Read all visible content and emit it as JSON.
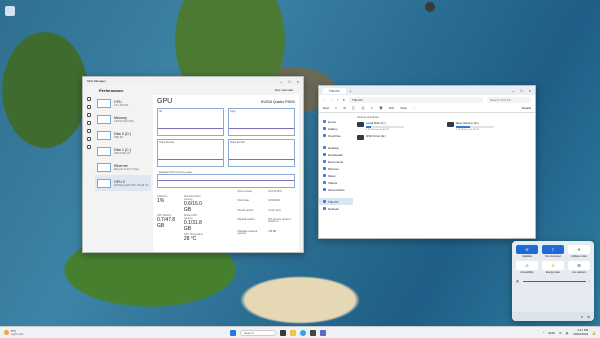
{
  "desktop": {
    "icons": [
      {
        "name": "recycle-bin-icon",
        "label": "Recycle Bin"
      },
      {
        "name": "camera-app-icon",
        "label": "Camera"
      }
    ]
  },
  "task_manager": {
    "window_title": "Task Manager",
    "section": "Performance",
    "run_task": "Run new task",
    "processes": [
      {
        "label": "CPU",
        "sub": "1% 1.59 GHz"
      },
      {
        "label": "Memory",
        "sub": "4.6/31.8 GB (14%)"
      },
      {
        "label": "Disk 0 (D:)",
        "sub": "HDD 0%"
      },
      {
        "label": "Disk 1 (C:)",
        "sub": "SSD NVMe 1%"
      },
      {
        "label": "Ethernet",
        "sub": "Ethernet S: 0 R: 0 Kbps"
      },
      {
        "label": "GPU 0",
        "sub": "NVIDIA Quadro RTX 1% (28 °C)"
      }
    ],
    "gpu": {
      "title": "GPU",
      "model": "NVIDIA Quadro P5000",
      "graphs": [
        "3D",
        "Copy",
        "Video Decode",
        "Video Encode"
      ],
      "dedicated_label": "Dedicated GPU memory usage",
      "stats": [
        {
          "k": "Utilization",
          "v": "1%"
        },
        {
          "k": "Dedicated GPU memory",
          "v": "0.6/16.0 GB"
        },
        {
          "k": "GPU Memory",
          "v": "0.7/47.8 GB"
        },
        {
          "k": "Shared GPU memory",
          "v": "0.1/31.8 GB"
        },
        {
          "k": "GPU Temperature",
          "v": "28 °C"
        }
      ],
      "details": [
        {
          "k": "Driver version:",
          "v": "31.0.15.3170"
        },
        {
          "k": "Driver date:",
          "v": "18/10/2023"
        },
        {
          "k": "DirectX version:",
          "v": "12 (FL 12.1)"
        },
        {
          "k": "Physical location:",
          "v": "PCI bus 101, device 0, function 0"
        },
        {
          "k": "Hardware reserved memory:",
          "v": "135 MB"
        }
      ]
    }
  },
  "file_explorer": {
    "tab": "This PC",
    "address": "This PC",
    "search_placeholder": "Search This PC",
    "commands": [
      "New",
      "Cut",
      "Copy",
      "Paste",
      "Rename",
      "Share",
      "Delete",
      "Sort",
      "View",
      "..."
    ],
    "details": "Details",
    "sidebar": [
      "Home",
      "Gallery",
      "OneDrive",
      "Desktop",
      "Downloads",
      "Documents",
      "Pictures",
      "Music",
      "Videos",
      "Screenshots",
      "This PC",
      "Network"
    ],
    "group_label": "Devices and drives",
    "drives": [
      {
        "name": "Local Disk (C:)",
        "free": "1.62 TB free of 1.86 TB",
        "used": 0.13
      },
      {
        "name": "New Volume (D:)",
        "free": "1.15 TB free of 1.81 TB",
        "used": 0.36
      },
      {
        "name": "DVD Drive (E:)",
        "free": "",
        "used": 0
      }
    ]
  },
  "quick_settings": {
    "tiles": [
      {
        "label": "Available",
        "glyph": "≋",
        "on": true
      },
      {
        "label": "Not connected",
        "glyph": "ᛒ",
        "on": true
      },
      {
        "label": "Airplane mode",
        "glyph": "✈",
        "on": false
      },
      {
        "label": "Accessibility",
        "glyph": "☺",
        "on": false
      },
      {
        "label": "Energy saver",
        "glyph": "⚡",
        "on": false
      },
      {
        "label": "Live captions",
        "glyph": "☰",
        "on": false
      }
    ],
    "volume": 85,
    "edit_glyph": "✎",
    "settings_glyph": "⚙"
  },
  "taskbar": {
    "weather_temp": "8°C",
    "weather_text": "Light rain",
    "search_placeholder": "Search",
    "time": "4:41 PM",
    "date": "29/02/2024",
    "lang": "ENG"
  },
  "colors": {
    "accent": "#1f6bd6",
    "graph": "#7f6bbf"
  }
}
